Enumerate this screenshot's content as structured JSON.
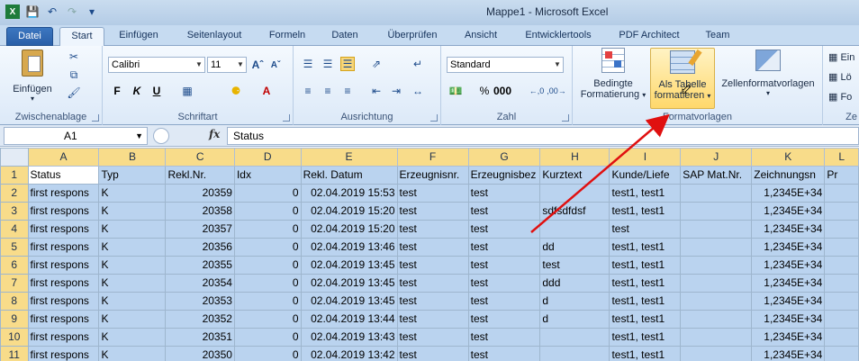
{
  "window": {
    "title": "Mappe1  -  Microsoft Excel"
  },
  "tabs": [
    "Datei",
    "Start",
    "Einfügen",
    "Seitenlayout",
    "Formeln",
    "Daten",
    "Überprüfen",
    "Ansicht",
    "Entwicklertools",
    "PDF Architect",
    "Team"
  ],
  "ribbon": {
    "clipboard": {
      "paste_label": "Einfügen",
      "group_label": "Zwischenablage"
    },
    "font": {
      "font_name": "Calibri",
      "font_size": "11",
      "group_label": "Schriftart"
    },
    "alignment": {
      "group_label": "Ausrichtung"
    },
    "number": {
      "format": "Standard",
      "group_label": "Zahl"
    },
    "styles": {
      "conditional_line1": "Bedingte",
      "conditional_line2": "Formatierung",
      "table_line1": "Als Tabelle",
      "table_line2": "formatieren",
      "cellstyles_label": "Zellenformatvorlagen",
      "group_label": "Formatvorlagen"
    },
    "cells": {
      "insert": "Ein",
      "delete": "Lö",
      "format": "Fo",
      "group_label": "Ze"
    }
  },
  "formula_bar": {
    "name_box": "A1",
    "fx": "fx",
    "formula": "Status"
  },
  "columns": [
    "A",
    "B",
    "C",
    "D",
    "E",
    "F",
    "G",
    "H",
    "I",
    "J",
    "K",
    "L"
  ],
  "rows": [
    {
      "n": "1",
      "cells": [
        "Status",
        "Typ",
        "Rekl.Nr.",
        "Idx",
        "Rekl. Datum",
        "Erzeugnisnr.",
        "Erzeugnisbez",
        "Kurztext",
        "Kunde/Liefe",
        "SAP Mat.Nr.",
        "Zeichnungsn",
        "Pr"
      ]
    },
    {
      "n": "2",
      "cells": [
        "first respons",
        "K",
        "20359",
        "0",
        "02.04.2019 15:53",
        "test",
        "test",
        "",
        "test1, test1",
        "",
        "1,2345E+34",
        ""
      ]
    },
    {
      "n": "3",
      "cells": [
        "first respons",
        "K",
        "20358",
        "0",
        "02.04.2019 15:20",
        "test",
        "test",
        "sdfsdfdsf",
        "test1, test1",
        "",
        "1,2345E+34",
        ""
      ]
    },
    {
      "n": "4",
      "cells": [
        "first respons",
        "K",
        "20357",
        "0",
        "02.04.2019 15:20",
        "test",
        "test",
        "",
        "test",
        "",
        "1,2345E+34",
        ""
      ]
    },
    {
      "n": "5",
      "cells": [
        "first respons",
        "K",
        "20356",
        "0",
        "02.04.2019 13:46",
        "test",
        "test",
        "dd",
        "test1, test1",
        "",
        "1,2345E+34",
        ""
      ]
    },
    {
      "n": "6",
      "cells": [
        "first respons",
        "K",
        "20355",
        "0",
        "02.04.2019 13:45",
        "test",
        "test",
        "test",
        "test1, test1",
        "",
        "1,2345E+34",
        ""
      ]
    },
    {
      "n": "7",
      "cells": [
        "first respons",
        "K",
        "20354",
        "0",
        "02.04.2019 13:45",
        "test",
        "test",
        "ddd",
        "test1, test1",
        "",
        "1,2345E+34",
        ""
      ]
    },
    {
      "n": "8",
      "cells": [
        "first respons",
        "K",
        "20353",
        "0",
        "02.04.2019 13:45",
        "test",
        "test",
        "d",
        "test1, test1",
        "",
        "1,2345E+34",
        ""
      ]
    },
    {
      "n": "9",
      "cells": [
        "first respons",
        "K",
        "20352",
        "0",
        "02.04.2019 13:44",
        "test",
        "test",
        "d",
        "test1, test1",
        "",
        "1,2345E+34",
        ""
      ]
    },
    {
      "n": "10",
      "cells": [
        "first respons",
        "K",
        "20351",
        "0",
        "02.04.2019 13:43",
        "test",
        "test",
        "",
        "test1, test1",
        "",
        "1,2345E+34",
        ""
      ]
    },
    {
      "n": "11",
      "cells": [
        "first respons",
        "K",
        "20350",
        "0",
        "02.04.2019 13:42",
        "test",
        "test",
        "",
        "test1, test1",
        "",
        "1,2345E+34",
        ""
      ]
    }
  ],
  "colors": {
    "accent": "#2a5fa8",
    "header_highlight": "#f8dc8a",
    "selection": "#bad3ef",
    "annotation_arrow": "#e01010"
  }
}
